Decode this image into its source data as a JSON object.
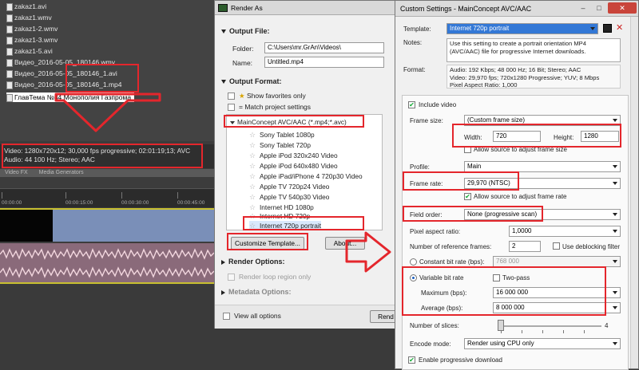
{
  "vegas": {
    "files": [
      {
        "name": "zakaz1.avi"
      },
      {
        "name": "zakaz1.wmv"
      },
      {
        "name": "zakaz1-2.wmv"
      },
      {
        "name": "zakaz1-3.wmv"
      },
      {
        "name": "zakaz1-5.avi"
      },
      {
        "name": "Видео_2016-05-05_180146.wmv"
      },
      {
        "name": "Видео_2016-05-05_180146_1.avi"
      },
      {
        "name": "Видео_2016-05-05_180146_1.mp4"
      },
      {
        "name": "ГлавТема №84 Монополия Газпрома"
      }
    ],
    "media_info_line1": "Video: 1280x720x12; 30,000 fps progressive; 02:01:19;13; AVC",
    "media_info_line2": "Audio: 44 100 Hz; Stereo; AAC",
    "tabs": [
      "Video FX",
      "Media Generators"
    ],
    "ticks": [
      "00:00:00",
      "00:00:15:00",
      "00:00:30:00",
      "00:00:45:00"
    ]
  },
  "render_as": {
    "title": "Render As",
    "output_file_header": "Output File:",
    "folder_label": "Folder:",
    "folder_value": "C:\\Users\\mr.GrAn\\Videos\\",
    "name_label": "Name:",
    "name_value": "Untitled.mp4",
    "output_format_header": "Output Format:",
    "show_favorites": "Show favorites only",
    "match_project": "Match project settings",
    "format_group": "MainConcept AVC/AAC (*.mp4;*.avc)",
    "templates": [
      {
        "label": "Sony Tablet 1080p"
      },
      {
        "label": "Sony Tablet 720p"
      },
      {
        "label": "Apple iPod 320x240 Video"
      },
      {
        "label": "Apple iPod 640x480 Video"
      },
      {
        "label": "Apple iPad/iPhone 4 720p30 Video"
      },
      {
        "label": "Apple TV 720p24 Video"
      },
      {
        "label": "Apple TV 540p30 Video"
      },
      {
        "label": "Internet HD 1080p"
      },
      {
        "label": "Internet HD 720p"
      },
      {
        "label": "Internet 720p portrait"
      }
    ],
    "customize_button": "Customize Template...",
    "about_button": "About...",
    "render_options_header": "Render Options:",
    "render_loop": "Render loop region only",
    "metadata_header": "Metadata Options:",
    "view_all": "View all options",
    "render_button": "Rend"
  },
  "custom": {
    "title": "Custom Settings - MainConcept AVC/AAC",
    "template_label": "Template:",
    "template_value": "Internet 720p portrait",
    "notes_label": "Notes:",
    "notes_value": "Use this setting to create a portrait orientation MP4 (AVC/AAC) file for progressive Internet downloads.",
    "format_label": "Format:",
    "format_line1": "Audio: 192 Kbps; 48 000 Hz; 16 Bit; Stereo; AAC",
    "format_line2": "Video: 29,970 fps; 720x1280 Progressive; YUV; 8 Mbps",
    "format_line3": "Pixel Aspect Ratio: 1,000",
    "include_video": "Include video",
    "frame_size_label": "Frame size:",
    "frame_size_value": "(Custom frame size)",
    "width_label": "Width:",
    "width_value": "720",
    "height_label": "Height:",
    "height_value": "1280",
    "allow_adjust_size": "Allow source to adjust frame size",
    "profile_label": "Profile:",
    "profile_value": "Main",
    "frame_rate_label": "Frame rate:",
    "frame_rate_value": "29,970 (NTSC)",
    "allow_adjust_rate": "Allow source to adjust frame rate",
    "field_order_label": "Field order:",
    "field_order_value": "None (progressive scan)",
    "par_label": "Pixel aspect ratio:",
    "par_value": "1,0000",
    "ref_frames_label": "Number of reference frames:",
    "ref_frames_value": "2",
    "deblocking_label": "Use deblocking filter",
    "cbr_label": "Constant bit rate (bps):",
    "cbr_value": "768 000",
    "vbr_label": "Variable bit rate",
    "two_pass_label": "Two-pass",
    "max_label": "Maximum (bps):",
    "max_value": "16 000 000",
    "avg_label": "Average (bps):",
    "avg_value": "8 000 000",
    "slices_label": "Number of slices:",
    "slices_value": "4",
    "slices_fraction": 0.0,
    "encode_label": "Encode mode:",
    "encode_value": "Render using CPU only",
    "progressive_label": "Enable progressive download"
  }
}
